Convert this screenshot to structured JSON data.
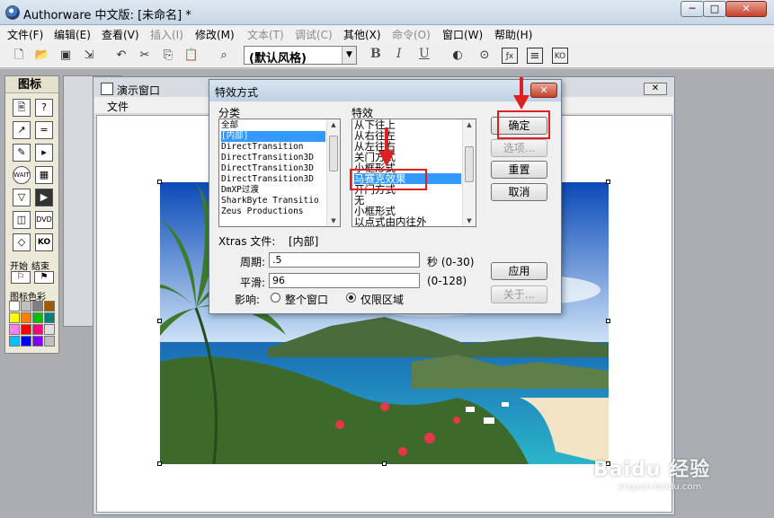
{
  "app": {
    "title": "Authorware 中文版: [未命名] *",
    "min": "─",
    "max": "□",
    "close": "✕"
  },
  "menu": [
    "文件(F)",
    "编辑(E)",
    "查看(V)",
    "插入(I)",
    "修改(M)",
    "文本(T)",
    "调试(C)",
    "其他(X)",
    "命令(O)",
    "窗口(W)",
    "帮助(H)"
  ],
  "menu_disabled": [
    3,
    5,
    6,
    8
  ],
  "toolbar": {
    "style_select": "(默认风格)",
    "bold": "B",
    "italic": "I",
    "underline": "U"
  },
  "palette": {
    "title": "图标",
    "start_label": "开始",
    "end_label": "结束",
    "color_title": "图标色彩",
    "colors": [
      "#ffffff",
      "#c0c0c0",
      "#808080",
      "#a05a00",
      "#ffff00",
      "#ff8000",
      "#00c000",
      "#008080",
      "#ff80ff",
      "#ff0000",
      "#ff0080",
      "#e0e0e0",
      "#00c0ff",
      "#0000ff",
      "#8000ff",
      "#c0c0c0"
    ]
  },
  "presentation_window": {
    "title": "演示窗口",
    "menu_file": "文件",
    "close": "✕"
  },
  "dialog": {
    "title": "特效方式",
    "close": "✕",
    "category_label": "分类",
    "effect_label": "特效",
    "categories": [
      "全部",
      "[内部]",
      "DirectTransition",
      "DirectTransition3D",
      "DirectTransition3D",
      "DirectTransition3D",
      "DmXP过渡",
      "SharkByte Transitio",
      "Zeus Productions"
    ],
    "categories_selected": 1,
    "effects": [
      "从下往上",
      "从右往左",
      "从左往右",
      "关门方式",
      "小框形式",
      "马赛克效果",
      "开门方式",
      "无",
      "小框形式",
      "以点式由内往外"
    ],
    "effects_selected": 5,
    "xtras_label": "Xtras 文件:",
    "xtras_value": "[内部]",
    "period_label": "周期:",
    "period_value": ".5",
    "period_unit": "秒 (0-30)",
    "smooth_label": "平滑:",
    "smooth_value": "96",
    "smooth_range": "(0-128)",
    "affect_label": "影响:",
    "radio_whole": "整个窗口",
    "radio_area": "仅限区域",
    "btn_ok": "确定",
    "btn_options": "选项...",
    "btn_reset": "重置",
    "btn_cancel": "取消",
    "btn_apply": "应用",
    "btn_about": "关于..."
  },
  "watermark": {
    "main": "Baidu 经验",
    "sub": "jingyan.baidu.com"
  }
}
